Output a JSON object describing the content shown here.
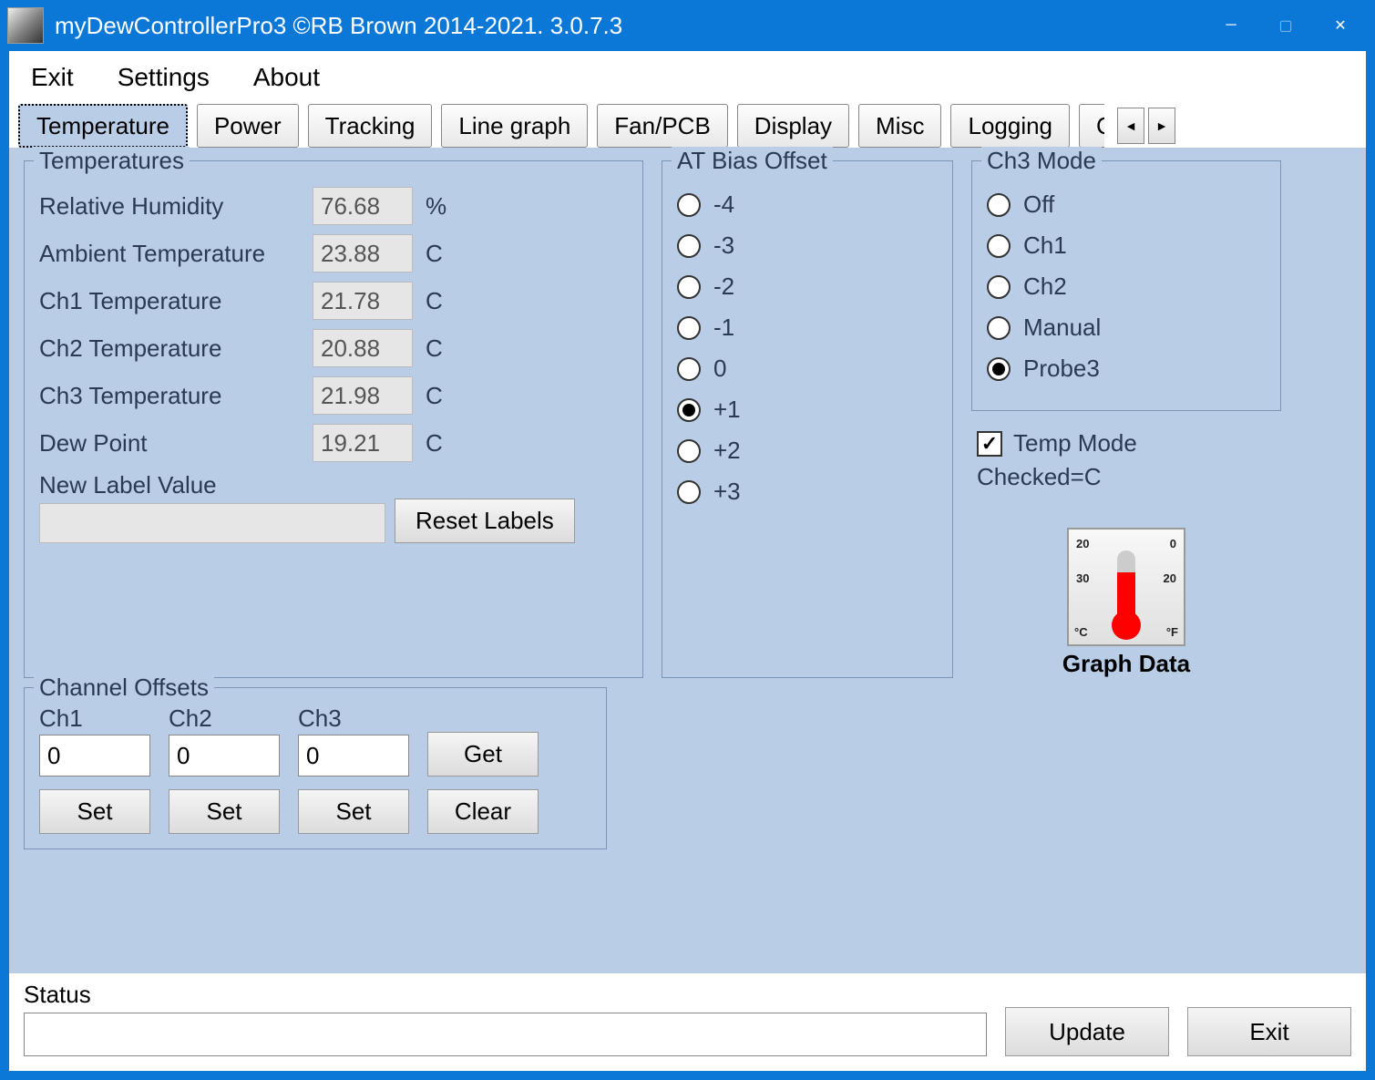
{
  "titlebar": {
    "text": "myDewControllerPro3 ©RB Brown 2014-2021. 3.0.7.3"
  },
  "menu": {
    "exit": "Exit",
    "settings": "Settings",
    "about": "About"
  },
  "tabs": {
    "temperature": "Temperature",
    "power": "Power",
    "tracking": "Tracking",
    "linegraph": "Line graph",
    "fanpcb": "Fan/PCB",
    "display": "Display",
    "misc": "Misc",
    "logging": "Logging",
    "clipped": "C"
  },
  "temperatures": {
    "legend": "Temperatures",
    "rows": [
      {
        "label": "Relative Humidity",
        "value": "76.68",
        "unit": "%"
      },
      {
        "label": "Ambient Temperature",
        "value": "23.88",
        "unit": "C"
      },
      {
        "label": "Ch1 Temperature",
        "value": "21.78",
        "unit": "C"
      },
      {
        "label": "Ch2 Temperature",
        "value": "20.88",
        "unit": "C"
      },
      {
        "label": "Ch3 Temperature",
        "value": "21.98",
        "unit": "C"
      },
      {
        "label": "Dew Point",
        "value": "19.21",
        "unit": "C"
      }
    ],
    "new_label": "New Label Value",
    "reset_button": "Reset Labels"
  },
  "atbias": {
    "legend": "AT Bias Offset",
    "options": [
      "-4",
      "-3",
      "-2",
      "-1",
      "0",
      "+1",
      "+2",
      "+3"
    ],
    "selected": "+1"
  },
  "ch3mode": {
    "legend": "Ch3 Mode",
    "options": [
      "Off",
      "Ch1",
      "Ch2",
      "Manual",
      "Probe3"
    ],
    "selected": "Probe3"
  },
  "temp_mode": {
    "label": "Temp Mode",
    "checked": true,
    "sublabel": "Checked=C"
  },
  "graph_data": {
    "label": "Graph Data"
  },
  "offsets": {
    "legend": "Channel Offsets",
    "ch1": {
      "label": "Ch1",
      "value": "0"
    },
    "ch2": {
      "label": "Ch2",
      "value": "0"
    },
    "ch3": {
      "label": "Ch3",
      "value": "0"
    },
    "get": "Get",
    "set": "Set",
    "clear": "Clear"
  },
  "status": {
    "label": "Status",
    "value": "",
    "update": "Update",
    "exit": "Exit"
  },
  "thermo_ticks": {
    "tl": "20",
    "tr": "0",
    "ml": "30",
    "mr": "20",
    "bl": "°C",
    "br": "°F"
  }
}
